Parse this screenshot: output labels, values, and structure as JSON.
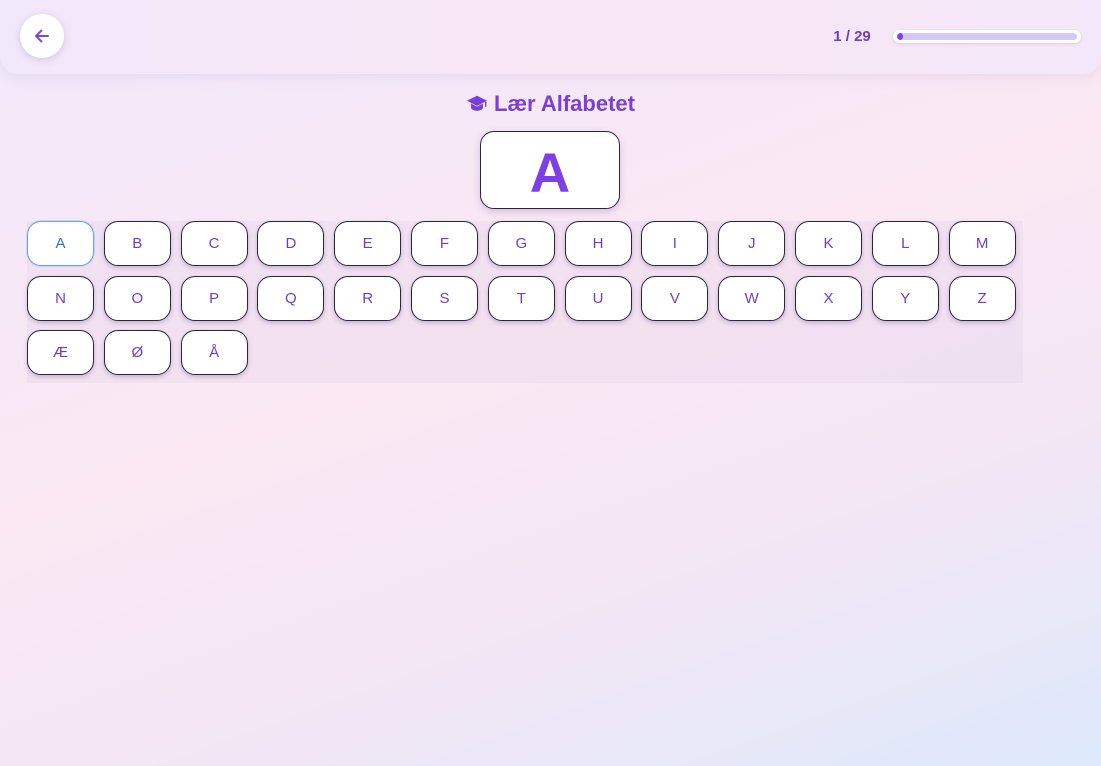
{
  "header": {
    "back_icon": "arrow-left-icon",
    "progress_text": "1 / 29",
    "progress_fraction": 0.034
  },
  "title": {
    "icon": "graduation-cap-icon",
    "text": "Lær Alfabetet"
  },
  "current_letter": "A",
  "colors": {
    "accent": "#7a3fd8",
    "selected_border": "#6aa3ee"
  },
  "letters": [
    "A",
    "B",
    "C",
    "D",
    "E",
    "F",
    "G",
    "H",
    "I",
    "J",
    "K",
    "L",
    "M",
    "N",
    "O",
    "P",
    "Q",
    "R",
    "S",
    "T",
    "U",
    "V",
    "W",
    "X",
    "Y",
    "Z",
    "Æ",
    "Ø",
    "Å"
  ],
  "selected_index": 0
}
